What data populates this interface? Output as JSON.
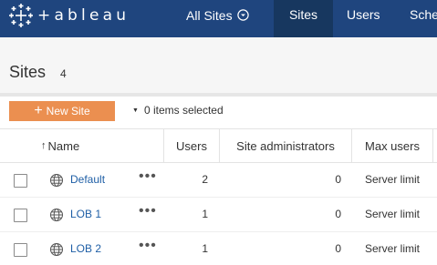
{
  "topbar": {
    "logo_text": "+ableau",
    "logo_icon": "tableau-logo-icon",
    "site_switcher_label": "All Sites",
    "site_switcher_icon": "chevron-circle-down-icon",
    "tabs": [
      {
        "label": "Sites",
        "active": true
      },
      {
        "label": "Users",
        "active": false
      },
      {
        "label": "Sche",
        "active": false
      }
    ]
  },
  "page": {
    "title": "Sites",
    "count": "4"
  },
  "toolbar": {
    "new_site_label": "New Site",
    "new_site_icon": "plus-icon",
    "selected_label": "0 items selected",
    "selected_icon": "caret-down-icon"
  },
  "table": {
    "columns": [
      "Name",
      "Users",
      "Site administrators",
      "Max users"
    ],
    "sort_icon": "sort-ascending-icon",
    "rows": [
      {
        "name": "Default",
        "users": "2",
        "admins": "0",
        "max_users": "Server limit"
      },
      {
        "name": "LOB 1",
        "users": "1",
        "admins": "0",
        "max_users": "Server limit"
      },
      {
        "name": "LOB 2",
        "users": "1",
        "admins": "0",
        "max_users": "Server limit"
      }
    ]
  },
  "colors": {
    "nav_bg": "#1f457e",
    "nav_active": "#17375f",
    "accent": "#eb8f50",
    "link": "#1f5fa6"
  }
}
